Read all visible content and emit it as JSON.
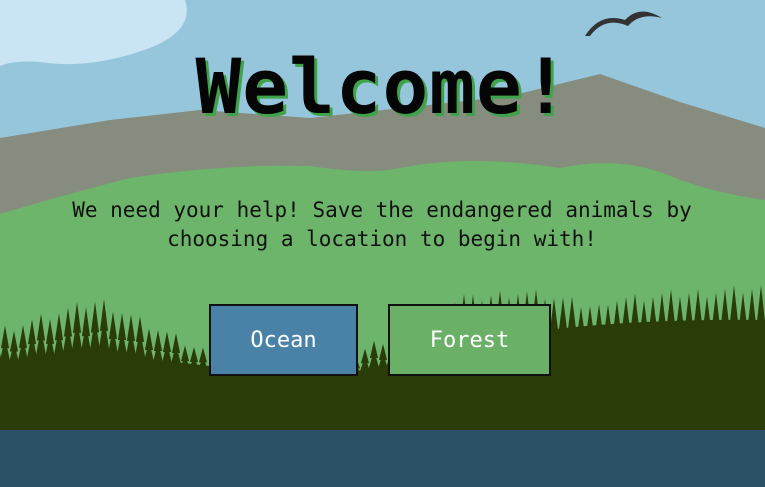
{
  "header": {
    "title": "Welcome!"
  },
  "intro": {
    "message": "We need your help! Save the endangered animals by choosing a location to begin with!"
  },
  "locations": [
    {
      "label": "Ocean",
      "color": "#4a82a7"
    },
    {
      "label": "Forest",
      "color": "#6bb067"
    }
  ],
  "scene": {
    "sky_color": "#96c6dc",
    "cloud_color": "#c9e4f3",
    "mountain_color": "#868d7f",
    "hill_color": "#6db56a",
    "tree_color": "#2a3d08",
    "water_color": "#2a5066",
    "bird_color": "#333333"
  }
}
